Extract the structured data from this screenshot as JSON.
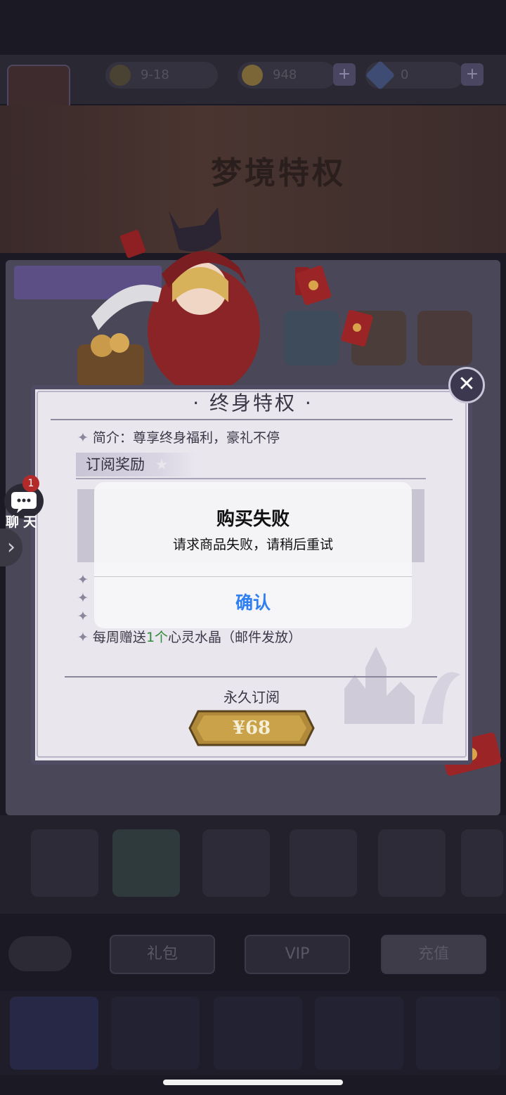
{
  "topbar": {
    "resources": [
      {
        "icon": "trophy-icon",
        "value": "9-18"
      },
      {
        "icon": "gold-coin-icon",
        "value": "948"
      },
      {
        "icon": "diamond-icon",
        "value": "0"
      }
    ],
    "plus_label": "+"
  },
  "banner": {
    "title": "梦境特权"
  },
  "chat": {
    "label": "聊天",
    "badge": "1",
    "icon": "chat-bubble-icon"
  },
  "dialog": {
    "title": "· 终身特权 ·",
    "intro_prefix": "简介：",
    "intro_text": "尊享终身福利，豪礼不停",
    "subhead": "订阅奖励",
    "benefit_prefix": "每周赠送",
    "benefit_count": "1个",
    "benefit_suffix": "心灵水晶（邮件发放）",
    "subscription_label": "永久订阅",
    "price": "¥68",
    "close_icon": "close-icon"
  },
  "alert": {
    "title": "购买失败",
    "message": "请求商品失败，请稍后重试",
    "confirm_label": "确认"
  },
  "bottom_tabs": [
    "礼包",
    "VIP",
    "充值"
  ],
  "colors": {
    "alert_button": "#2f7ff0",
    "benefit_highlight": "#2f8a3a",
    "badge_red": "#b32a2a",
    "price_gold": "#c9a24a"
  }
}
